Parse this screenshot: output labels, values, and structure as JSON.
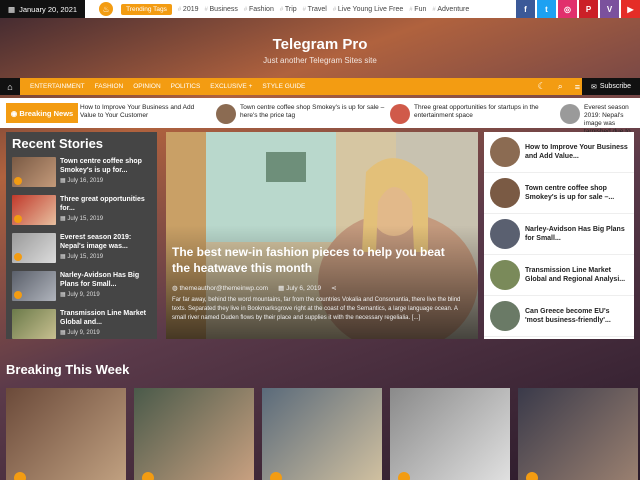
{
  "topbar": {
    "date": "January 20, 2021",
    "trending_label": "Trending Tags",
    "tags": [
      "2019",
      "Business",
      "Fashion",
      "Trip",
      "Travel",
      "Live Young Live Free",
      "Fun",
      "Adventure"
    ],
    "socials": [
      {
        "icon": "facebook-icon",
        "glyph": "f",
        "color": "#3b5998"
      },
      {
        "icon": "twitter-icon",
        "glyph": "t",
        "color": "#1da1f2"
      },
      {
        "icon": "instagram-icon",
        "glyph": "◎",
        "color": "#e1306c"
      },
      {
        "icon": "pinterest-icon",
        "glyph": "P",
        "color": "#cb2027"
      },
      {
        "icon": "viber-icon",
        "glyph": "V",
        "color": "#7b519d"
      },
      {
        "icon": "youtube-icon",
        "glyph": "▶",
        "color": "#e52d27"
      }
    ]
  },
  "header": {
    "title": "Telegram Pro",
    "tagline": "Just another Telegram Sites site"
  },
  "nav": {
    "items": [
      "ENTERTAINMENT",
      "FASHION",
      "OPINION",
      "POLITICS",
      "EXCLUSIVE",
      "STYLE GUIDE"
    ],
    "subscribe": "Subscribe"
  },
  "ticker": {
    "label": "Breaking News",
    "items": [
      {
        "title": "How to Improve Your Business and Add Value to Your Customer"
      },
      {
        "title": "Town centre coffee shop Smokey's is up for sale – here's the price tag"
      },
      {
        "title": "Three great opportunities for startups in the entertainment space"
      },
      {
        "title": "Everest season 2019: Nepal's image was tarnished due to"
      }
    ]
  },
  "recent": {
    "heading": "Recent Stories",
    "items": [
      {
        "title": "Town centre coffee shop Smokey's is up for...",
        "date": "July 16, 2019"
      },
      {
        "title": "Three great opportunities for...",
        "date": "July 15, 2019"
      },
      {
        "title": "Everest season 2019: Nepal's image was...",
        "date": "July 15, 2019"
      },
      {
        "title": "Narley-Avidson Has Big Plans for Small...",
        "date": "July 9, 2019"
      },
      {
        "title": "Transmission Line Market Global and...",
        "date": "July 9, 2019"
      }
    ]
  },
  "featured": {
    "title": "The best new-in fashion pieces to help you beat the heatwave this month",
    "author": "themeauthor@themeinwp.com",
    "date": "July 6, 2019",
    "excerpt": "Far far away, behind the word mountains, far from the countries Vokalia and Consonantia, there live the blind texts. Separated they live in Bookmarksgrove right at the coast of the Semantics, a large language ocean. A small river named Duden flows by their place and supplies it with the necessary regelialia. [...]"
  },
  "right_list": [
    {
      "title": "How to Improve Your Business and Add Value..."
    },
    {
      "title": "Town centre coffee shop Smokey's is up for sale –..."
    },
    {
      "title": "Narley-Avidson Has Big Plans for Small..."
    },
    {
      "title": "Transmission Line Market Global and Regional Analysi..."
    },
    {
      "title": "Can Greece become EU's 'most business-friendly'..."
    }
  ],
  "breaking_week": {
    "heading": "Breaking This Week"
  }
}
